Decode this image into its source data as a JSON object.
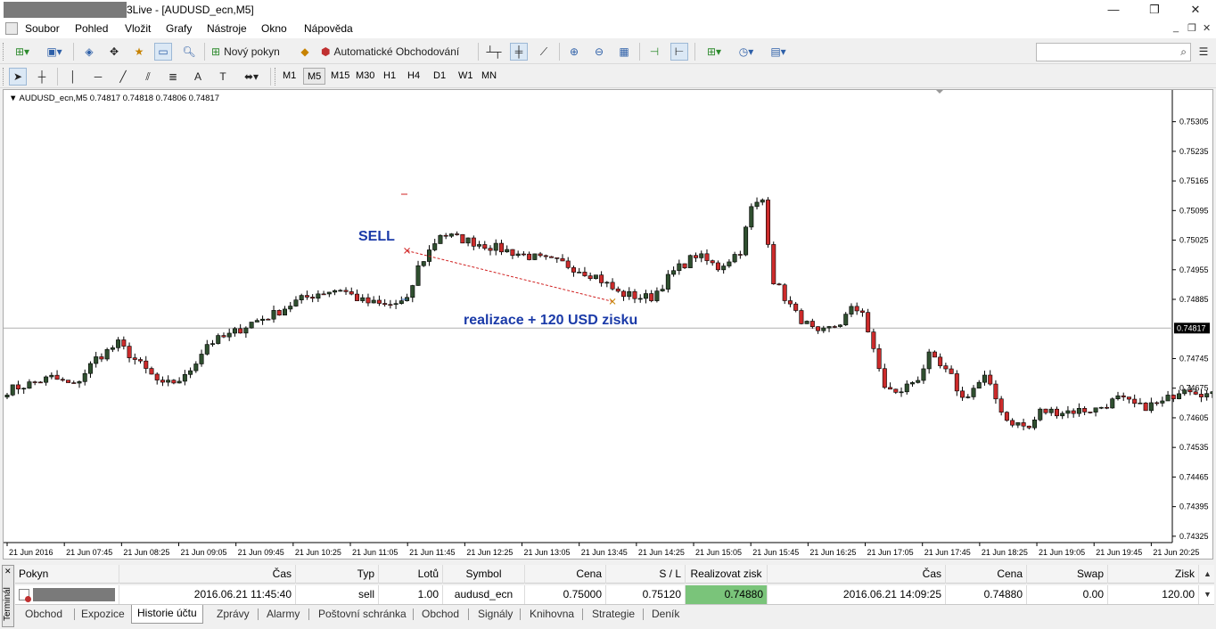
{
  "window": {
    "title_suffix": "3Live - [AUDUSD_ecn,M5]",
    "min": "—",
    "max": "❐",
    "close": "✕"
  },
  "menu": [
    "Soubor",
    "Pohled",
    "Vložit",
    "Grafy",
    "Nástroje",
    "Okno",
    "Nápověda"
  ],
  "toolbar": {
    "new_order": "Nový pokyn",
    "auto_trading": "Automatické Obchodování",
    "search_placeholder": ""
  },
  "timeframes": [
    "M1",
    "M5",
    "M15",
    "M30",
    "H1",
    "H4",
    "D1",
    "W1",
    "MN"
  ],
  "active_timeframe": "M5",
  "chart": {
    "header": "AUDUSD_ecn,M5  0.74817 0.74818 0.74806 0.74817",
    "current_price": "0.74817",
    "annotation_sell": "SELL",
    "annotation_profit": "realizace + 120 USD zisku",
    "colors": {
      "bull": "#2f4f2f",
      "bear": "#cc2b2b",
      "annotation": "#1a3aa8",
      "trade_line": "#d02020"
    }
  },
  "chart_data": {
    "type": "candlestick",
    "symbol": "AUDUSD_ecn",
    "timeframe": "M5",
    "ylim": [
      0.7431,
      0.7538
    ],
    "yticks": [
      "0.75305",
      "0.75235",
      "0.75165",
      "0.75095",
      "0.75025",
      "0.74955",
      "0.74885",
      "0.74817",
      "0.74745",
      "0.74675",
      "0.74605",
      "0.74535",
      "0.74465",
      "0.74395",
      "0.74325"
    ],
    "xticks": [
      "21 Jun 2016",
      "21 Jun 07:45",
      "21 Jun 08:25",
      "21 Jun 09:05",
      "21 Jun 09:45",
      "21 Jun 10:25",
      "21 Jun 11:05",
      "21 Jun 11:45",
      "21 Jun 12:25",
      "21 Jun 13:05",
      "21 Jun 13:45",
      "21 Jun 14:25",
      "21 Jun 15:05",
      "21 Jun 15:45",
      "21 Jun 16:25",
      "21 Jun 17:05",
      "21 Jun 17:45",
      "21 Jun 18:25",
      "21 Jun 19:05",
      "21 Jun 19:45",
      "21 Jun 20:25"
    ],
    "anchors": [
      [
        0,
        0.7467
      ],
      [
        8,
        0.747
      ],
      [
        12,
        0.7468
      ],
      [
        16,
        0.74745
      ],
      [
        20,
        0.7478
      ],
      [
        24,
        0.7473
      ],
      [
        28,
        0.7468
      ],
      [
        32,
        0.747
      ],
      [
        36,
        0.7478
      ],
      [
        40,
        0.748
      ],
      [
        44,
        0.7483
      ],
      [
        48,
        0.7485
      ],
      [
        52,
        0.7488
      ],
      [
        56,
        0.749
      ],
      [
        60,
        0.7491
      ],
      [
        64,
        0.7488
      ],
      [
        68,
        0.7487
      ],
      [
        72,
        0.7488
      ],
      [
        74,
        0.7496
      ],
      [
        78,
        0.7504
      ],
      [
        84,
        0.7502
      ],
      [
        90,
        0.75
      ],
      [
        96,
        0.7498
      ],
      [
        100,
        0.7497
      ],
      [
        106,
        0.7494
      ],
      [
        110,
        0.749
      ],
      [
        114,
        0.7489
      ],
      [
        116,
        0.7489
      ],
      [
        120,
        0.7495
      ],
      [
        124,
        0.7499
      ],
      [
        128,
        0.7496
      ],
      [
        132,
        0.75
      ],
      [
        134,
        0.751
      ],
      [
        136,
        0.7512
      ],
      [
        138,
        0.7493
      ],
      [
        142,
        0.7485
      ],
      [
        146,
        0.748
      ],
      [
        150,
        0.7483
      ],
      [
        152,
        0.7486
      ],
      [
        154,
        0.7486
      ],
      [
        156,
        0.7476
      ],
      [
        158,
        0.7468
      ],
      [
        160,
        0.7466
      ],
      [
        164,
        0.747
      ],
      [
        166,
        0.7475
      ],
      [
        170,
        0.747
      ],
      [
        172,
        0.7465
      ],
      [
        176,
        0.747
      ],
      [
        178,
        0.7465
      ],
      [
        180,
        0.746
      ],
      [
        184,
        0.7458
      ],
      [
        186,
        0.7462
      ],
      [
        190,
        0.7462
      ],
      [
        196,
        0.74625
      ],
      [
        200,
        0.7465
      ],
      [
        204,
        0.7463
      ],
      [
        208,
        0.7464
      ],
      [
        212,
        0.7468
      ],
      [
        216,
        0.7466
      ],
      [
        222,
        0.7464
      ],
      [
        226,
        0.7465
      ]
    ],
    "sell_entry": {
      "time": "2016.06.21 11:45:40",
      "price": 0.75
    },
    "take_profit_exit": {
      "time": "2016.06.21 14:09:25",
      "price": 0.7488
    }
  },
  "terminal": {
    "side_label": "Terminál",
    "columns": [
      "Pokyn",
      "Čas",
      "Typ",
      "Lotů",
      "Symbol",
      "Cena",
      "S / L",
      "Realizovat zisk",
      "Čas",
      "Cena",
      "Swap",
      "Zisk"
    ],
    "row": {
      "open_time": "2016.06.21 11:45:40",
      "type": "sell",
      "lots": "1.00",
      "symbol": "audusd_ecn",
      "price": "0.75000",
      "sl": "0.75120",
      "tp": "0.74880",
      "close_time": "2016.06.21 14:09:25",
      "close_price": "0.74880",
      "swap": "0.00",
      "profit": "120.00"
    },
    "tabs": [
      "Obchod",
      "Expozice",
      "Historie účtu",
      "Zprávy",
      "Alarmy",
      "Poštovní schránka",
      "Obchod",
      "Signály",
      "Knihovna",
      "Strategie",
      "Deník"
    ],
    "active_tab": "Historie účtu"
  }
}
